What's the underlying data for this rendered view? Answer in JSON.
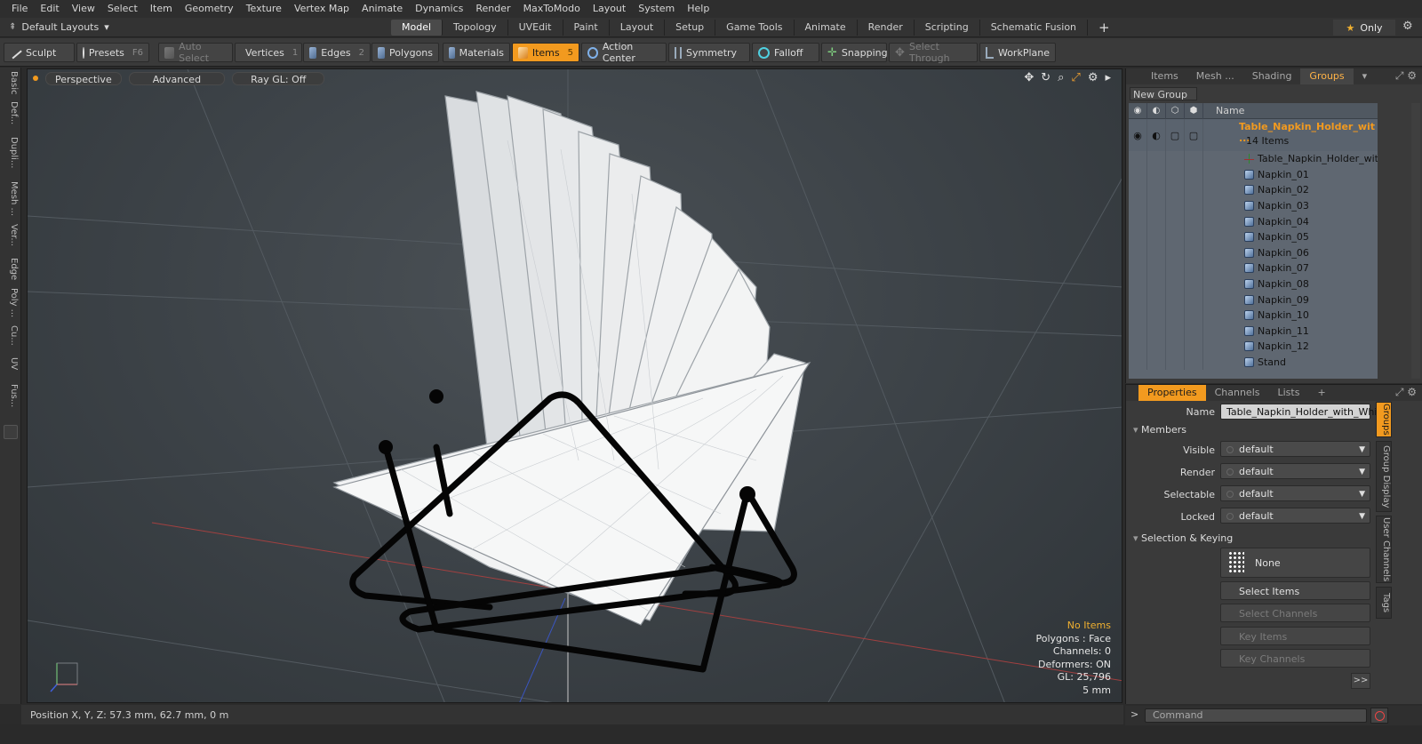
{
  "menu": [
    "File",
    "Edit",
    "View",
    "Select",
    "Item",
    "Geometry",
    "Texture",
    "Vertex Map",
    "Animate",
    "Dynamics",
    "Render",
    "MaxToModo",
    "Layout",
    "System",
    "Help"
  ],
  "layout_select": "Default Layouts",
  "tabs": [
    {
      "label": "Model",
      "active": true
    },
    {
      "label": "Topology"
    },
    {
      "label": "UVEdit"
    },
    {
      "label": "Paint"
    },
    {
      "label": "Layout"
    },
    {
      "label": "Setup"
    },
    {
      "label": "Game Tools"
    },
    {
      "label": "Animate"
    },
    {
      "label": "Render"
    },
    {
      "label": "Scripting"
    },
    {
      "label": "Schematic Fusion"
    }
  ],
  "tab_add": "+",
  "only_label": "Only",
  "toolbar": {
    "sculpt": "Sculpt",
    "presets": "Presets",
    "presets_key": "F6",
    "auto_select": "Auto Select",
    "vertices": "Vertices",
    "vertices_key": "1",
    "edges": "Edges",
    "edges_key": "2",
    "polygons": "Polygons",
    "materials": "Materials",
    "items": "Items",
    "items_key": "5",
    "action_center": "Action Center",
    "symmetry": "Symmetry",
    "falloff": "Falloff",
    "snapping": "Snapping",
    "select_through": "Select Through",
    "workplane": "WorkPlane"
  },
  "left_tabs": [
    "Basic",
    "Def...",
    "Dupli...",
    "Mesh ...",
    "Ver...",
    "Edge",
    "Poly ...",
    "Cu...",
    "UV",
    "Fus..."
  ],
  "viewport": {
    "perspective": "Perspective",
    "advanced": "Advanced",
    "raygl": "Ray GL: Off",
    "info": {
      "selection": "No Items",
      "polygons": "Polygons : Face",
      "channels": "Channels: 0",
      "deformers": "Deformers: ON",
      "gl": "GL: 25,796",
      "scale": "5 mm"
    }
  },
  "status": "Position X, Y, Z:   57.3 mm, 62.7 mm, 0 m",
  "right_tabs": [
    {
      "label": "Items"
    },
    {
      "label": "Mesh ..."
    },
    {
      "label": "Shading"
    },
    {
      "label": "Groups",
      "active": true
    }
  ],
  "new_group": "New Group",
  "tree": {
    "name_header": "Name",
    "group_title": "Table_Napkin_Holder_wit ...",
    "group_count": "14 Items",
    "items": [
      {
        "label": "Table_Napkin_Holder_with_ ...",
        "icon": "locator-icon"
      },
      {
        "label": "Napkin_01",
        "icon": "mesh-icon"
      },
      {
        "label": "Napkin_02",
        "icon": "mesh-icon"
      },
      {
        "label": "Napkin_03",
        "icon": "mesh-icon"
      },
      {
        "label": "Napkin_04",
        "icon": "mesh-icon"
      },
      {
        "label": "Napkin_05",
        "icon": "mesh-icon"
      },
      {
        "label": "Napkin_06",
        "icon": "mesh-icon"
      },
      {
        "label": "Napkin_07",
        "icon": "mesh-icon"
      },
      {
        "label": "Napkin_08",
        "icon": "mesh-icon"
      },
      {
        "label": "Napkin_09",
        "icon": "mesh-icon"
      },
      {
        "label": "Napkin_10",
        "icon": "mesh-icon"
      },
      {
        "label": "Napkin_11",
        "icon": "mesh-icon"
      },
      {
        "label": "Napkin_12",
        "icon": "mesh-icon"
      },
      {
        "label": "Stand",
        "icon": "mesh-icon"
      }
    ]
  },
  "props": {
    "tabs": [
      {
        "label": "Properties",
        "active": true
      },
      {
        "label": "Channels"
      },
      {
        "label": "Lists"
      },
      {
        "label": "+"
      }
    ],
    "name_label": "Name",
    "name_value": "Table_Napkin_Holder_with_White",
    "members_section": "Members",
    "visible_label": "Visible",
    "visible_value": "default",
    "render_label": "Render",
    "render_value": "default",
    "selectable_label": "Selectable",
    "selectable_value": "default",
    "locked_label": "Locked",
    "locked_value": "default",
    "selkey_section": "Selection & Keying",
    "none_label": "None",
    "select_items": "Select Items",
    "select_channels": "Select Channels",
    "key_items": "Key Items",
    "key_channels": "Key Channels",
    "more": ">>",
    "side_tabs": [
      "Groups",
      "Group Display",
      "User Channels",
      "Tags"
    ]
  },
  "command_placeholder": "Command",
  "colors": {
    "accent": "#f29a1f",
    "tree_bg": "#5f6771",
    "viewport": "#3c4247"
  }
}
